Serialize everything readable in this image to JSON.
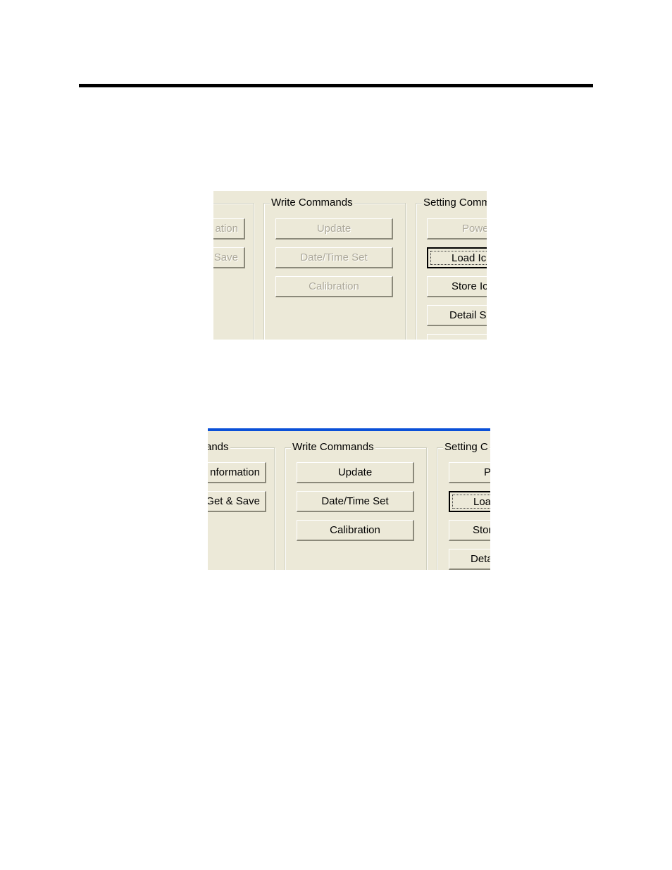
{
  "document": {
    "rule_color": "#000000"
  },
  "screenshots": [
    {
      "state": "disabled",
      "groups": {
        "left": {
          "label": "",
          "buttons": [
            {
              "label": "ation",
              "enabled": false
            },
            {
              "label": "Save",
              "enabled": false
            }
          ]
        },
        "write": {
          "label": "Write Commands",
          "buttons": [
            {
              "label": "Update",
              "enabled": false
            },
            {
              "label": "Date/Time Set",
              "enabled": false
            },
            {
              "label": "Calibration",
              "enabled": false
            }
          ]
        },
        "setting": {
          "label": "Setting Comm",
          "buttons": [
            {
              "label": "Powe",
              "enabled": false
            },
            {
              "label": "Load Ic",
              "enabled": true,
              "focused": true
            },
            {
              "label": "Store Ic",
              "enabled": true
            },
            {
              "label": "Detail S",
              "enabled": true
            }
          ]
        }
      }
    },
    {
      "state": "enabled",
      "titlebar_color": "#0a50d8",
      "groups": {
        "left": {
          "label": "ands",
          "buttons": [
            {
              "label": "nformation",
              "enabled": true
            },
            {
              "label": "Get & Save",
              "enabled": true
            }
          ]
        },
        "write": {
          "label": "Write Commands",
          "buttons": [
            {
              "label": "Update",
              "enabled": true
            },
            {
              "label": "Date/Time Set",
              "enabled": true
            },
            {
              "label": "Calibration",
              "enabled": true
            }
          ]
        },
        "setting": {
          "label": "Setting C",
          "buttons": [
            {
              "label": "P",
              "enabled": true
            },
            {
              "label": "Loa",
              "enabled": true,
              "focused": true
            },
            {
              "label": "Stor",
              "enabled": true
            },
            {
              "label": "Deta",
              "enabled": true
            }
          ]
        }
      }
    }
  ]
}
